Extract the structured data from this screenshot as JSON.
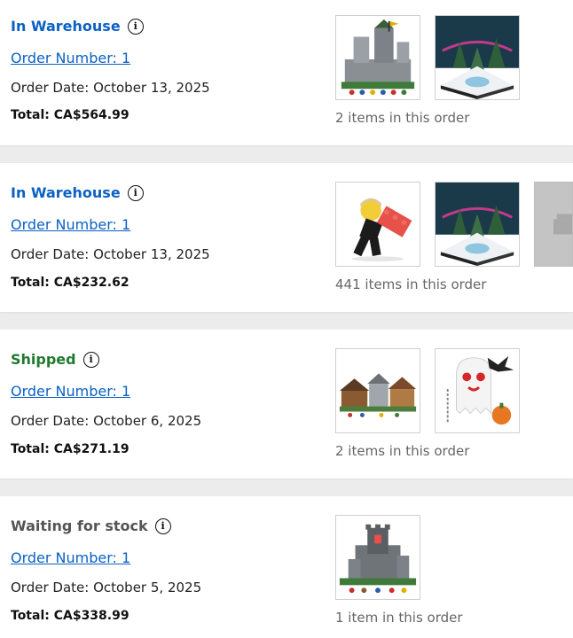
{
  "orders": [
    {
      "status": "In Warehouse",
      "status_color": "#0b61c4",
      "order_number_label": "Order Number: 1",
      "order_date": "Order Date: October 13, 2025",
      "total": "Total: CA$564.99",
      "items_count": "2 items in this order",
      "thumbnails": [
        "castle-set",
        "winter-scene-set"
      ]
    },
    {
      "status": "In Warehouse",
      "status_color": "#0b61c4",
      "order_number_label": "Order Number: 1",
      "order_date": "Order Date: October 13, 2025",
      "total": "Total: CA$232.62",
      "items_count": "441 items in this order",
      "thumbnails": [
        "minifigure-with-brick",
        "winter-scene-set",
        "placeholder"
      ]
    },
    {
      "status": "Shipped",
      "status_color": "#1f7a2e",
      "order_number_label": "Order Number: 1",
      "order_date": "Order Date: October 6, 2025",
      "total": "Total: CA$271.19",
      "items_count": "2 items in this order",
      "thumbnails": [
        "medieval-town-set",
        "ghost-halloween-set"
      ]
    },
    {
      "status": "Waiting for stock",
      "status_color": "#555555",
      "order_number_label": "Order Number: 1",
      "order_date": "Order Date: October 5, 2025",
      "total": "Total: CA$338.99",
      "items_count": "1 item in this order",
      "thumbnails": [
        "dark-castle-set"
      ]
    }
  ]
}
